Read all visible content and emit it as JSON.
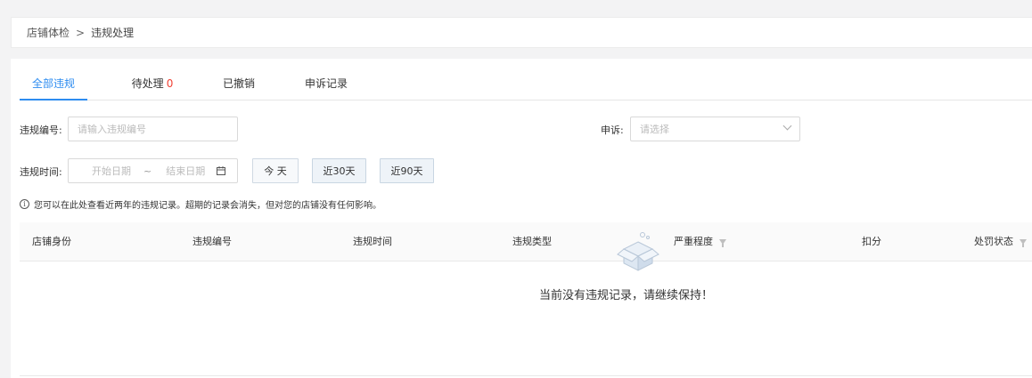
{
  "breadcrumb": {
    "parent": "店铺体检",
    "separator": ">",
    "current": "违规处理"
  },
  "tabs": [
    {
      "label": "全部违规",
      "active": true
    },
    {
      "label": "待处理",
      "count": "0"
    },
    {
      "label": "已撤销"
    },
    {
      "label": "申诉记录"
    }
  ],
  "filters": {
    "violation_no_label": "违规编号:",
    "violation_no_placeholder": "请输入违规编号",
    "appeal_label": "申诉:",
    "appeal_placeholder": "请选择",
    "time_label": "违规时间:",
    "start_placeholder": "开始日期",
    "range_sep": "~",
    "end_placeholder": "结束日期",
    "quick_today": "今 天",
    "quick_30": "近30天",
    "quick_90": "近90天"
  },
  "notice": "您可以在此处查看近两年的违规记录。超期的记录会消失，但对您的店铺没有任何影响。",
  "table": {
    "columns": [
      "店铺身份",
      "违规编号",
      "违规时间",
      "违规类型",
      "严重程度",
      "扣分",
      "处罚状态"
    ],
    "empty_text": "当前没有违规记录，请继续保持！"
  },
  "colors": {
    "accent": "#2d8cf0",
    "count": "#f04134"
  }
}
